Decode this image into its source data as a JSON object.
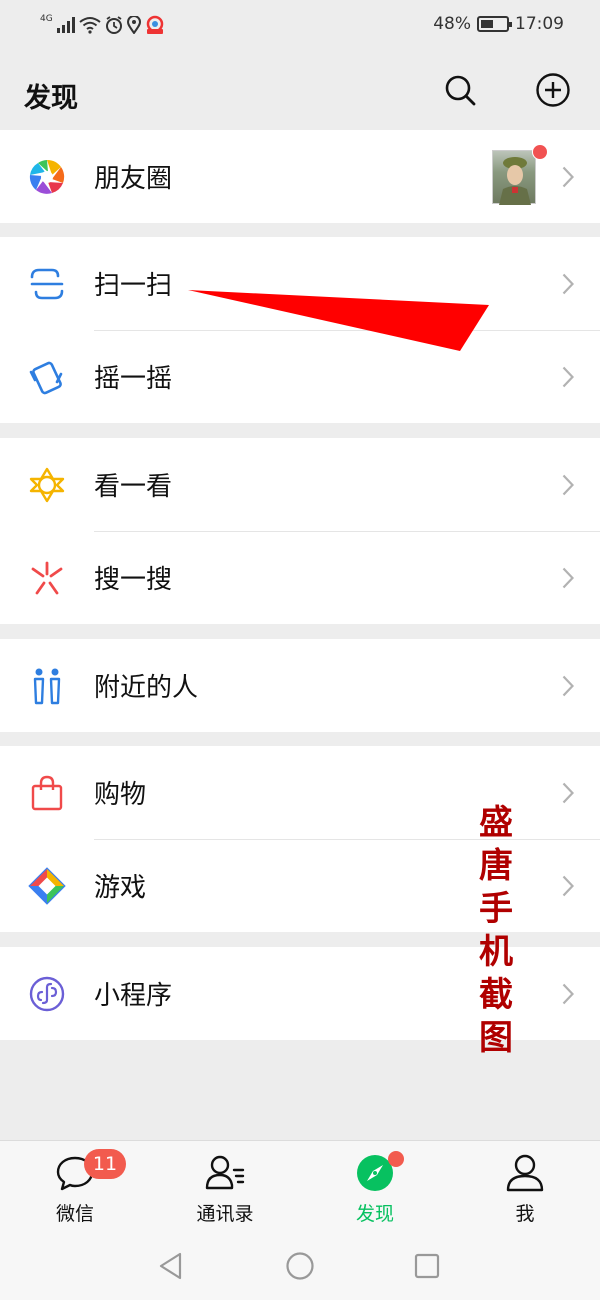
{
  "status_bar": {
    "network": "4G",
    "battery": "48%",
    "battery_level": 0.48,
    "time": "17:09"
  },
  "header": {
    "title": "发现",
    "search_icon": "search-icon",
    "add_icon": "plus-circle-icon"
  },
  "menu": {
    "groups": [
      [
        {
          "label": "朋友圈",
          "icon": "moments-icon",
          "has_new": true
        }
      ],
      [
        {
          "label": "扫一扫",
          "icon": "scan-icon"
        },
        {
          "label": "摇一摇",
          "icon": "shake-icon"
        }
      ],
      [
        {
          "label": "看一看",
          "icon": "top-stories-icon"
        },
        {
          "label": "搜一搜",
          "icon": "search-star-icon"
        }
      ],
      [
        {
          "label": "附近的人",
          "icon": "people-nearby-icon"
        }
      ],
      [
        {
          "label": "购物",
          "icon": "shopping-bag-icon"
        },
        {
          "label": "游戏",
          "icon": "games-icon"
        }
      ],
      [
        {
          "label": "小程序",
          "icon": "mini-programs-icon"
        }
      ]
    ]
  },
  "watermark": {
    "chars": [
      "盛",
      "唐",
      "手",
      "机",
      "截",
      "图"
    ],
    "color": "#b00000"
  },
  "tabs": [
    {
      "label": "微信",
      "icon": "chat-bubble-icon",
      "badge": "11"
    },
    {
      "label": "通讯录",
      "icon": "contacts-icon"
    },
    {
      "label": "发现",
      "icon": "discover-compass-icon",
      "active": true,
      "dot": true
    },
    {
      "label": "我",
      "icon": "person-icon"
    }
  ],
  "colors": {
    "accent": "#07c160",
    "badge": "#f25b4e",
    "arrow": "#ff0000"
  }
}
